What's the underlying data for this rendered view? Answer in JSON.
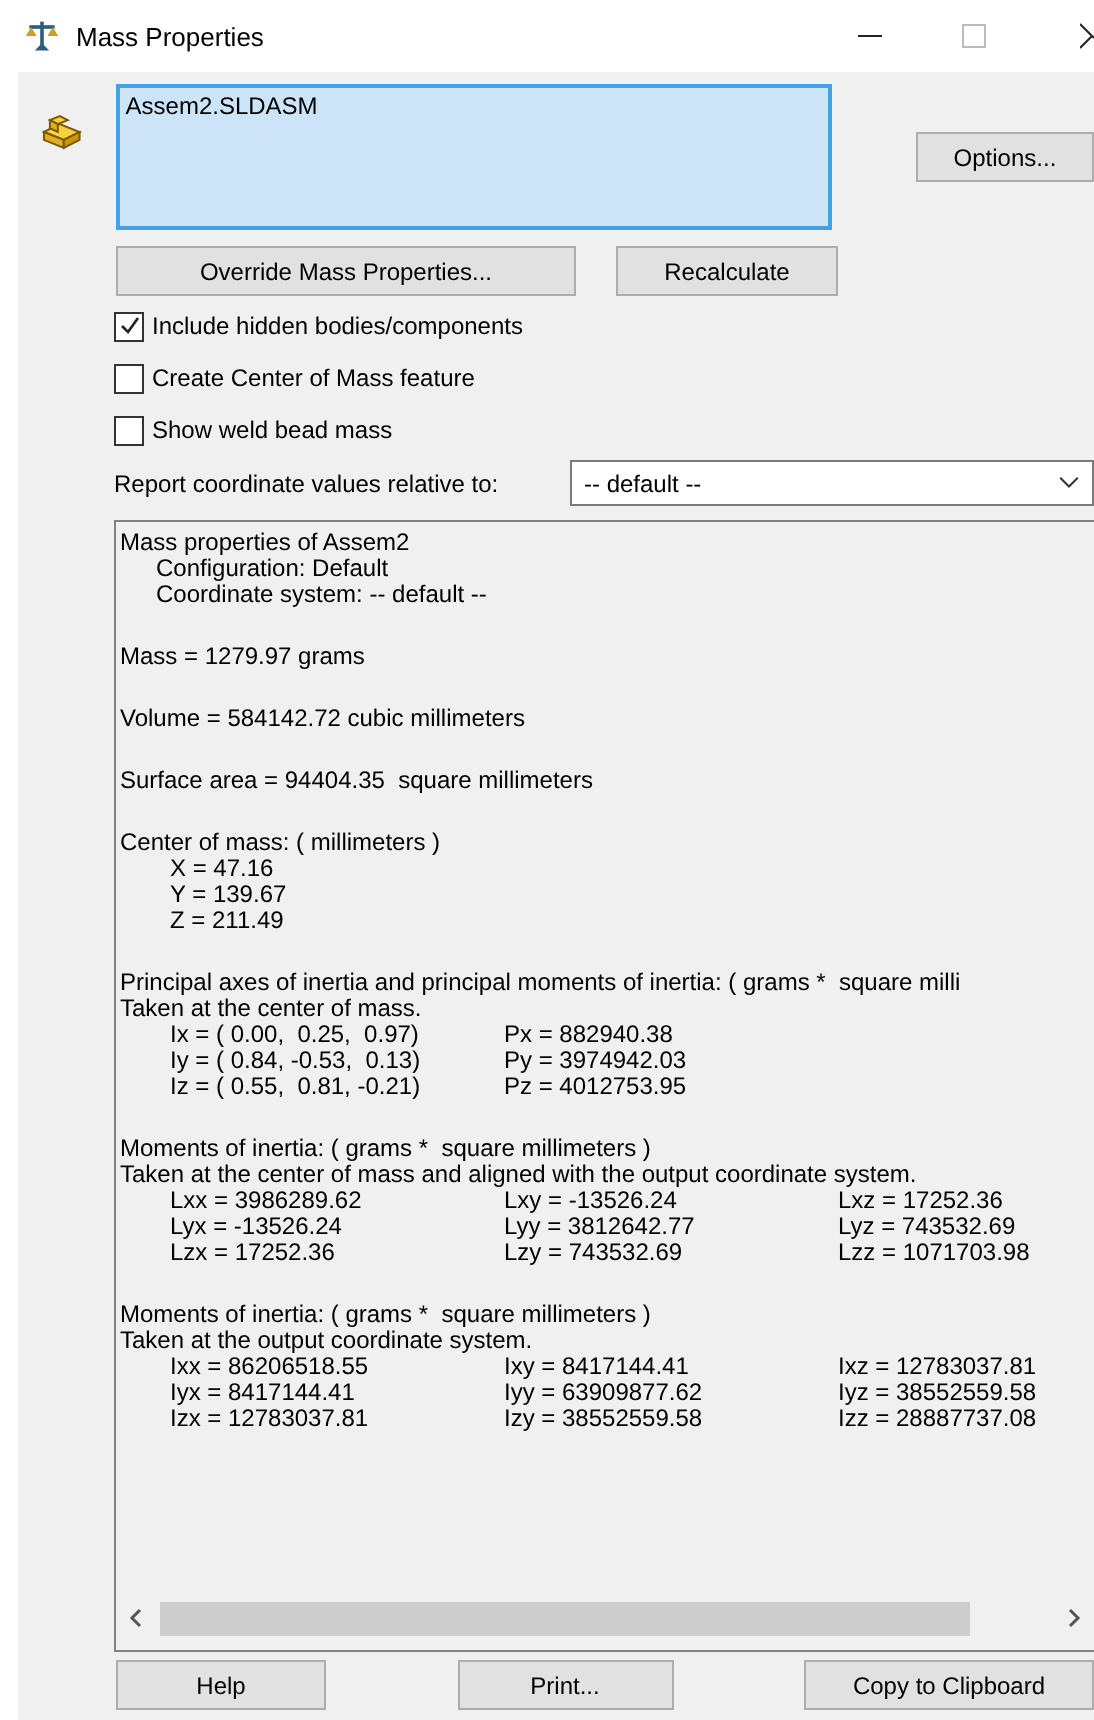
{
  "window": {
    "title": "Mass Properties"
  },
  "selection": {
    "items": [
      "Assem2.SLDASM"
    ]
  },
  "buttons_top": {
    "options": "Options...",
    "override": "Override Mass Properties...",
    "recalculate": "Recalculate"
  },
  "checkboxes": [
    {
      "label": "Include hidden bodies/components",
      "checked": true
    },
    {
      "label": "Create Center of Mass feature",
      "checked": false
    },
    {
      "label": "Show weld bead mass",
      "checked": false
    }
  ],
  "coordinate": {
    "label": "Report coordinate values relative to:",
    "value": "-- default --"
  },
  "report": {
    "lines": [
      {
        "kind": "text",
        "text": "Mass properties of Assem2"
      },
      {
        "kind": "indented",
        "text": "Configuration: Default"
      },
      {
        "kind": "indented",
        "text": "Coordinate system: -- default --"
      },
      {
        "kind": "gap"
      },
      {
        "kind": "text",
        "text": "Mass = 1279.97 grams"
      },
      {
        "kind": "gap"
      },
      {
        "kind": "text",
        "text": "Volume = 584142.72 cubic millimeters"
      },
      {
        "kind": "gap"
      },
      {
        "kind": "text",
        "text": "Surface area = 94404.35  square millimeters"
      },
      {
        "kind": "gap"
      },
      {
        "kind": "text",
        "text": "Center of mass: ( millimeters )"
      },
      {
        "kind": "value",
        "text": "X = 47.16"
      },
      {
        "kind": "value",
        "text": "Y = 139.67"
      },
      {
        "kind": "value",
        "text": "Z = 211.49"
      },
      {
        "kind": "gap"
      },
      {
        "kind": "text",
        "text": "Principal axes of inertia and principal moments of inertia: ( grams *  square milli"
      },
      {
        "kind": "text",
        "text": "Taken at the center of mass."
      },
      {
        "kind": "row",
        "cells": [
          "Ix = ( 0.00,  0.25,  0.97)",
          "Px = 882940.38"
        ]
      },
      {
        "kind": "row",
        "cells": [
          "Iy = ( 0.84, -0.53,  0.13)",
          "Py = 3974942.03"
        ]
      },
      {
        "kind": "row",
        "cells": [
          "Iz = ( 0.55,  0.81, -0.21)",
          "Pz = 4012753.95"
        ]
      },
      {
        "kind": "gap"
      },
      {
        "kind": "text",
        "text": "Moments of inertia: ( grams *  square millimeters )"
      },
      {
        "kind": "text",
        "text": "Taken at the center of mass and aligned with the output coordinate system."
      },
      {
        "kind": "row",
        "cells": [
          "Lxx = 3986289.62",
          "Lxy = -13526.24",
          "Lxz = 17252.36"
        ]
      },
      {
        "kind": "row",
        "cells": [
          "Lyx = -13526.24",
          "Lyy = 3812642.77",
          "Lyz = 743532.69"
        ]
      },
      {
        "kind": "row",
        "cells": [
          "Lzx = 17252.36",
          "Lzy = 743532.69",
          "Lzz = 1071703.98"
        ]
      },
      {
        "kind": "gap"
      },
      {
        "kind": "text",
        "text": "Moments of inertia: ( grams *  square millimeters )"
      },
      {
        "kind": "text",
        "text": "Taken at the output coordinate system."
      },
      {
        "kind": "row",
        "cells": [
          "Ixx = 86206518.55",
          "Ixy = 8417144.41",
          "Ixz = 12783037.81"
        ]
      },
      {
        "kind": "row",
        "cells": [
          "Iyx = 8417144.41",
          "Iyy = 63909877.62",
          "Iyz = 38552559.58"
        ]
      },
      {
        "kind": "row",
        "cells": [
          "Izx = 12783037.81",
          "Izy = 38552559.58",
          "Izz = 28887737.08"
        ]
      }
    ]
  },
  "buttons_bottom": [
    "Help",
    "Print...",
    "Copy to Clipboard"
  ]
}
